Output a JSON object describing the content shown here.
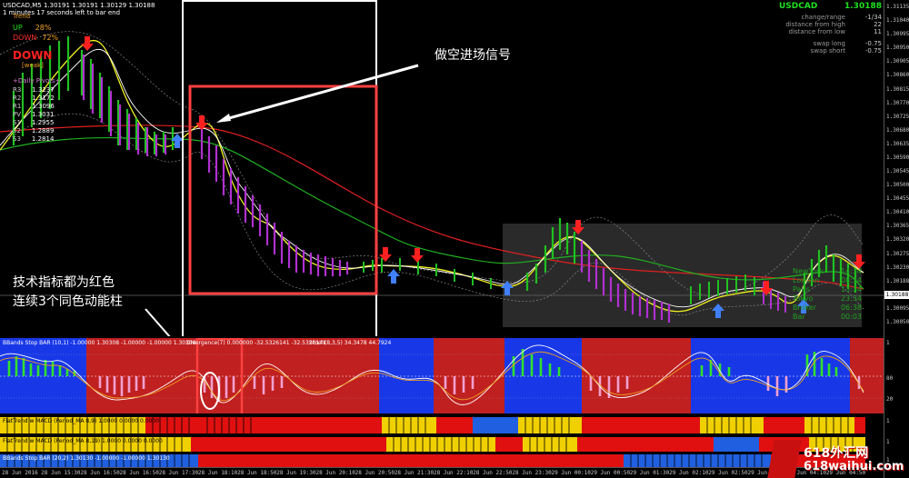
{
  "chart": {
    "title": "USDCAD,M5  1.30191 1.30191 1.30129 1.30188",
    "timer": "1 minutes 17 seconds left to bar end",
    "price_current": "1.30188"
  },
  "trend_panel": {
    "trend_label": "Trend",
    "up_label": "UP",
    "up_value": "28%",
    "down_label": "DOWN",
    "down_value": "72%",
    "big_label": "DOWN",
    "strength": "[weak]",
    "pivots_title": "+Daily Pivots+",
    "pivots": [
      {
        "name": "R3",
        "value": "1.3237"
      },
      {
        "name": "R2",
        "value": "1.3172"
      },
      {
        "name": "R1",
        "value": "1.3096"
      },
      {
        "name": "PV",
        "value": "1.3031"
      },
      {
        "name": "S1",
        "value": "1.2955"
      },
      {
        "name": "S2",
        "value": "1.2889"
      },
      {
        "name": "S3",
        "value": "1.2814"
      }
    ]
  },
  "info_panel": {
    "symbol": "USDCAD",
    "price": "1.30188",
    "rows": [
      {
        "label": "change/range",
        "value": "-1/34"
      },
      {
        "label": "distance from high",
        "value": "22"
      },
      {
        "label": "distance from low",
        "value": "11"
      },
      {
        "label": "swap long",
        "value": "-0.75"
      },
      {
        "label": "swap short",
        "value": "-0.75"
      }
    ]
  },
  "sessions": [
    {
      "label": "NewYork",
      "value": "14:34"
    },
    {
      "label": "London",
      "value": "08:34"
    },
    {
      "label": "Paris",
      "value": "13:34"
    },
    {
      "label": "Tokyo",
      "value": "23:34"
    },
    {
      "label": "Broker",
      "value": "06:38"
    },
    {
      "label": "Bar",
      "value": "00:03"
    }
  ],
  "annotations": {
    "short_signal": "做空进场信号",
    "red_indicators_1": "技术指标都为红色",
    "red_indicators_2": "连续3个同色动能柱"
  },
  "indicators": {
    "bb_title": "BBands Stop BAR (10,1) -1.00000 1.30308 -1.00000 -1.00000 1.30308",
    "div_title": "Divergence(7) 0.000000 -32.5326141 -32.5326141",
    "stoch_title": "Stoch(8,3,5) 34.3478 44.7924",
    "flat1_title": "FlatTrend w MACD (Period_MA 8,9) 1.0000 0.0000 0.0000",
    "flat2_title": "FlatTrend w MACD (Period_MA 8,19) 1.0000 0.0000 0.0000",
    "bb2_title": "BBands Stop BAR (20,2) 1.30130 -1.00000 -1.00000 1.30130"
  },
  "price_axis": [
    "1.31135",
    "1.31040",
    "1.30995",
    "1.30950",
    "1.30905",
    "1.30860",
    "1.30815",
    "1.30770",
    "1.30725",
    "1.30680",
    "1.30635",
    "1.30590",
    "1.30545",
    "1.30500",
    "1.30455",
    "1.30410",
    "1.30365",
    "1.30320",
    "1.30275",
    "1.30230",
    "1.30188",
    "1.30140",
    "1.30095",
    "1.30050"
  ],
  "sub_axis": [
    "1",
    "80",
    "20",
    "1",
    "1",
    "1"
  ],
  "time_axis": [
    "28 Jun 2016",
    "28 Jun 15:30",
    "28 Jun 16:50",
    "28 Jun 16:50",
    "28 Jun 17:30",
    "28 Jun 18:10",
    "28 Jun 18:50",
    "28 Jun 19:30",
    "28 Jun 20:10",
    "28 Jun 20:50",
    "28 Jun 21:30",
    "28 Jun 22:10",
    "28 Jun 22:50",
    "28 Jun 23:30",
    "29 Jun 00:10",
    "29 Jun 00:50",
    "29 Jun 01:30",
    "29 Jun 02:10",
    "29 Jun 02:50",
    "29 Jun 03:30",
    "29 Jun 04:10",
    "29 Jun 04:50"
  ],
  "watermark": {
    "line1": "618外汇网",
    "line2": "618waihui.com"
  }
}
